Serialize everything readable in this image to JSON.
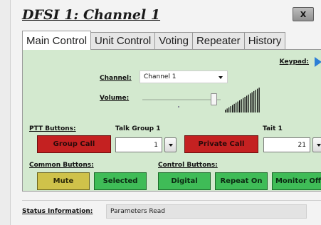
{
  "window": {
    "title": "DFSI 1: Channel 1",
    "close_label": "X"
  },
  "tabs": [
    {
      "label": "Main Control",
      "active": true
    },
    {
      "label": "Unit Control",
      "active": false
    },
    {
      "label": "Voting",
      "active": false
    },
    {
      "label": "Repeater",
      "active": false
    },
    {
      "label": "History",
      "active": false
    }
  ],
  "main": {
    "keypad_label": "Keypad:",
    "channel_label": "Channel:",
    "channel_value": "Channel 1",
    "volume_label": "Volume:",
    "volume_level": 0.95,
    "ptt_label": "PTT Buttons:",
    "talkgroup_label": "Talk Group 1",
    "talkgroup_value": "1",
    "group_call_label": "Group Call",
    "private_call_label": "Private Call",
    "tait_label": "Tait 1",
    "tait_value": "21",
    "common_label": "Common Buttons:",
    "control_label": "Control Buttons:",
    "mute_label": "Mute",
    "selected_label": "Selected",
    "digital_label": "Digital",
    "repeat_label": "Repeat On",
    "monitor_label": "Monitor Off"
  },
  "status": {
    "label": "Status Information:",
    "value": "Parameters Read"
  },
  "colors": {
    "panel_bg": "#d3e9cf",
    "red_button": "#c42121",
    "yellow_button": "#cfc24a",
    "green_button": "#3fbc57",
    "keypad_arrow": "#2d7fd6"
  }
}
